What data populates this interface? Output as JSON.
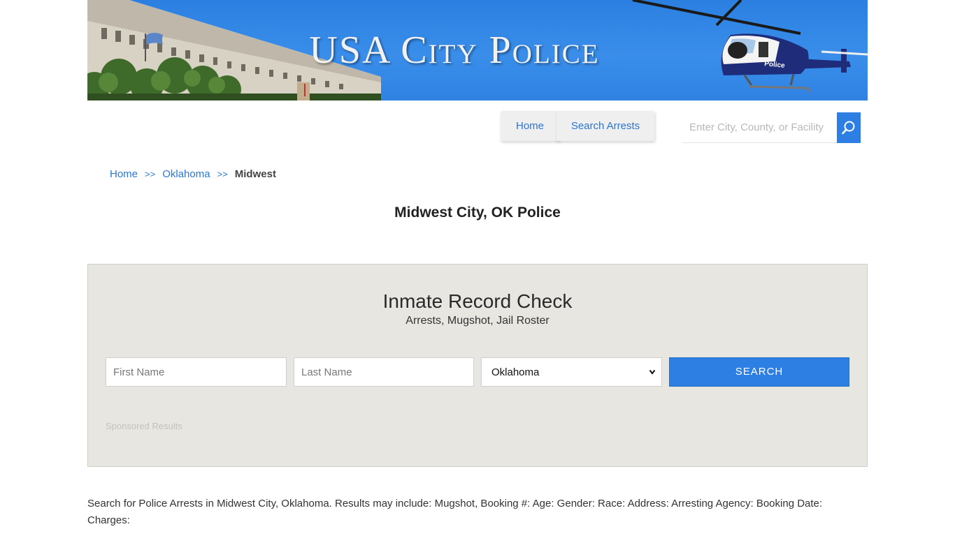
{
  "banner": {
    "title": "USA City Police",
    "helicopter_label": "Police"
  },
  "nav": {
    "home_label": "Home",
    "search_arrests_label": "Search Arrests"
  },
  "site_search": {
    "placeholder": "Enter City, County, or Facility"
  },
  "breadcrumb": {
    "home": "Home",
    "separator": ">>",
    "state": "Oklahoma",
    "current": "Midwest"
  },
  "page_title": "Midwest City, OK Police",
  "record_check": {
    "title": "Inmate Record Check",
    "subtitle": "Arrests, Mugshot, Jail Roster",
    "first_name_placeholder": "First Name",
    "last_name_placeholder": "Last Name",
    "state_selected": "Oklahoma",
    "search_label": "SEARCH",
    "sponsored": "Sponsored Results"
  },
  "description": "Search for Police Arrests in Midwest City, Oklahoma. Results may include: Mugshot, Booking #: Age: Gender: Race: Address: Arresting Agency: Booking Date: Charges:",
  "colors": {
    "accent": "#2e7fe3",
    "link": "#2a76d6",
    "panel_bg": "#e8e6e1"
  }
}
